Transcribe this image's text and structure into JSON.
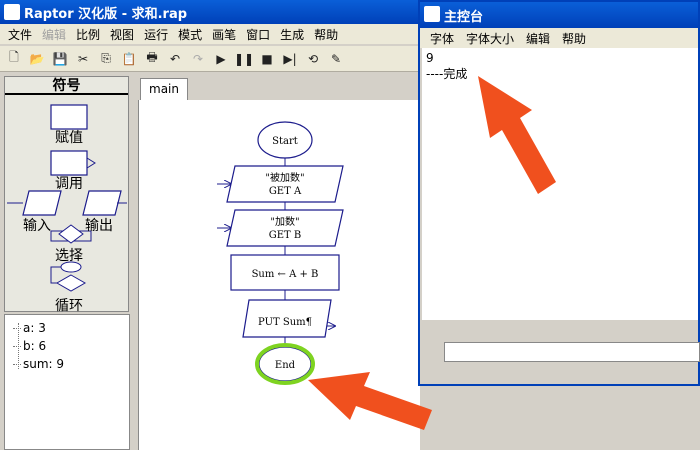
{
  "main_window": {
    "title": "Raptor 汉化版 - 求和.rap",
    "menu": [
      "文件",
      "编辑",
      "比例",
      "视图",
      "运行",
      "模式",
      "画笔",
      "窗口",
      "生成",
      "帮助"
    ],
    "menu_disabled": "编辑"
  },
  "palette": {
    "title": "符号",
    "assign": "赋值",
    "call": "调用",
    "input": "输入",
    "output": "输出",
    "select": "选择",
    "loop": "循环"
  },
  "watch": {
    "items": [
      "a: 3",
      "b: 6",
      "sum: 9"
    ]
  },
  "tab": {
    "label": "main"
  },
  "flowchart": {
    "start": "Start",
    "input1_prompt": "\"被加数\"",
    "input1_get": "GET A",
    "input2_prompt": "\"加数\"",
    "input2_get": "GET B",
    "assign": "Sum ← A + B",
    "output": "PUT Sum¶",
    "end": "End"
  },
  "console": {
    "title": "主控台",
    "menu": [
      "字体",
      "字体大小",
      "编辑",
      "帮助"
    ],
    "output_lines": [
      "9",
      "----完成"
    ]
  },
  "colors": {
    "highlight_ring": "#7ed321",
    "arrow": "#f0501e",
    "flow_stroke": "#1c1c8c"
  }
}
